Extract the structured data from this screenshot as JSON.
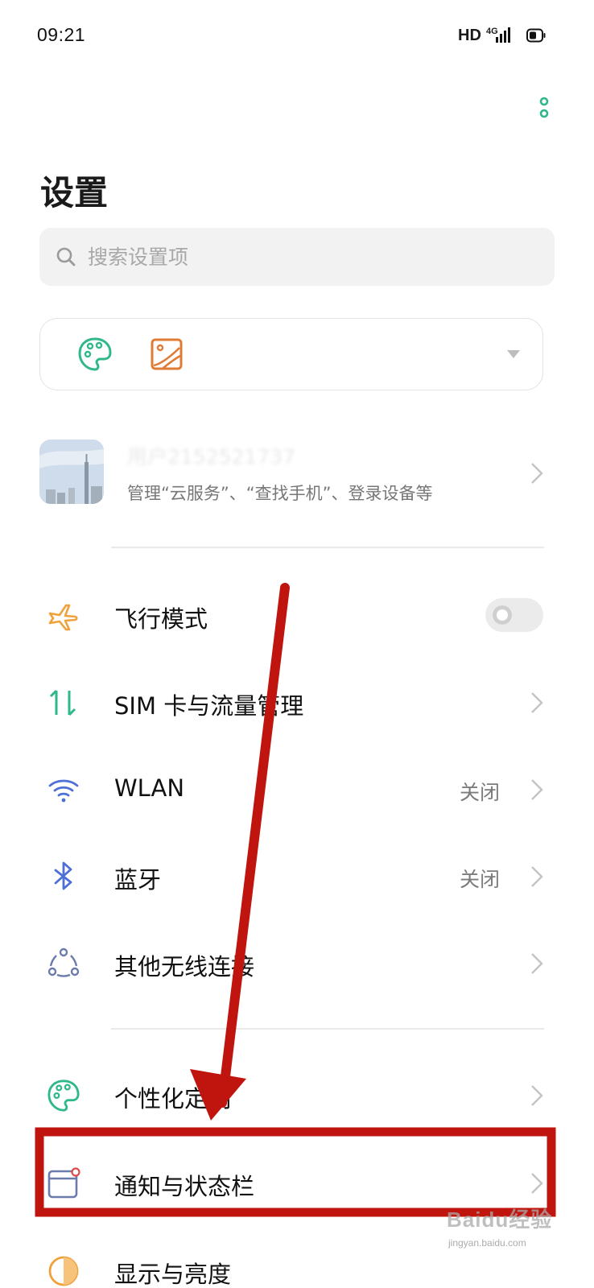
{
  "status_bar": {
    "time": "09:21",
    "hd": "HD",
    "network": "4G",
    "icons": [
      "signal-icon",
      "battery-icon"
    ]
  },
  "header": {
    "title": "设置",
    "menu_icon": "more-vertical-icon"
  },
  "search": {
    "placeholder": "搜索设置项",
    "icon": "search-icon"
  },
  "theme_card": {
    "icons": [
      "palette-icon",
      "wallpaper-icon",
      "chevron-down-icon"
    ]
  },
  "account": {
    "name": "用户2152521737",
    "subtitle": "管理“云服务”、“查找手机”、登录设备等"
  },
  "settings": [
    {
      "id": "airplane",
      "label": "飞行模式",
      "icon": "airplane-icon",
      "icon_color": "#f0a13a",
      "control": "toggle",
      "toggle_on": false
    },
    {
      "id": "sim",
      "label": "SIM 卡与流量管理",
      "icon": "sim-data-icon",
      "icon_color": "#2fb88b",
      "control": "chevron"
    },
    {
      "id": "wlan",
      "label": "WLAN",
      "value": "关闭",
      "icon": "wifi-icon",
      "icon_color": "#4d6fd6",
      "control": "chevron"
    },
    {
      "id": "bluetooth",
      "label": "蓝牙",
      "value": "关闭",
      "icon": "bluetooth-icon",
      "icon_color": "#4d6fd6",
      "control": "chevron"
    },
    {
      "id": "other-wireless",
      "label": "其他无线连接",
      "icon": "connections-icon",
      "icon_color": "#6b7bab",
      "control": "chevron"
    },
    {
      "id": "personalize",
      "label": "个性化定制",
      "icon": "palette-icon",
      "icon_color": "#2fb88b",
      "control": "chevron"
    },
    {
      "id": "notifications",
      "label": "通知与状态栏",
      "icon": "notification-icon",
      "icon_color": "#6b7bab",
      "control": "chevron"
    },
    {
      "id": "display",
      "label": "显示与亮度",
      "icon": "display-icon",
      "icon_color": "#f0a13a",
      "control": "chevron"
    }
  ],
  "colors": {
    "accent": "#2fb88b",
    "annotation": "#c0140e"
  },
  "watermark": {
    "logo": "Baidu经验",
    "url": "jingyan.baidu.com"
  }
}
